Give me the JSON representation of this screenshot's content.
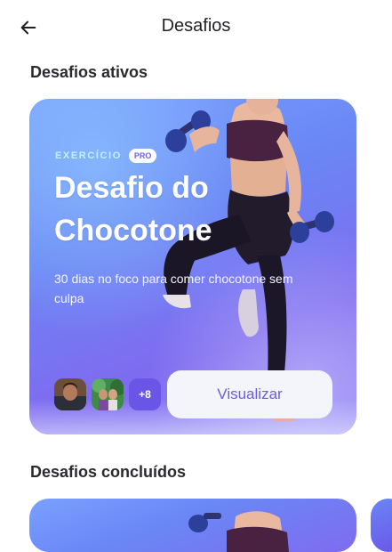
{
  "header": {
    "title": "Desafios",
    "back_icon": "arrow-left-icon"
  },
  "sections": {
    "active_title": "Desafios ativos",
    "completed_title": "Desafios concluídos"
  },
  "active_challenge": {
    "category": "EXERCÍCIO",
    "badge": "PRO",
    "title": "Desafio do Chocotone",
    "description": "30 dias no foco para comer chocotone sem culpa",
    "participants_more": "+8",
    "view_button": "Visualizar"
  },
  "colors": {
    "accent": "#6c5ed8",
    "card_gradient_start": "#7aa0ff",
    "card_gradient_end": "#8c7cf6",
    "category_text": "#bff3ff"
  }
}
